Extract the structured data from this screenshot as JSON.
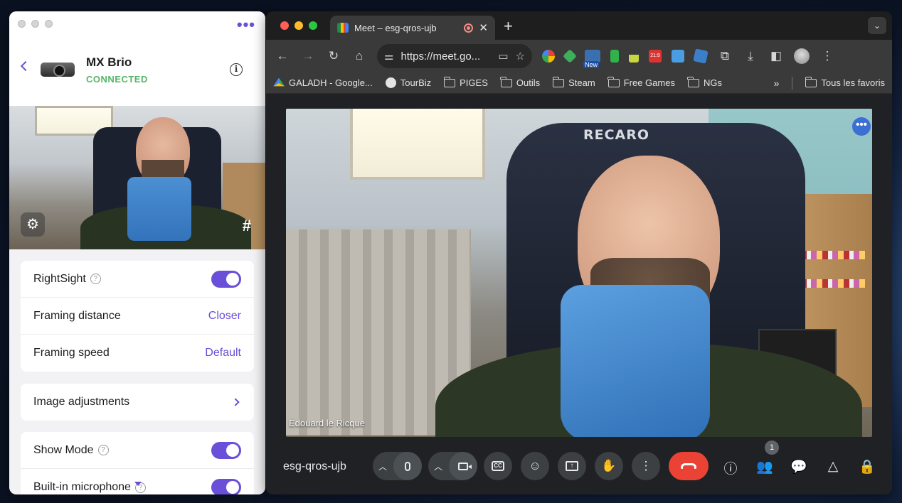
{
  "logi": {
    "more_icon": "ellipsis-icon",
    "device_name": "MX Brio",
    "device_status": "CONNECTED",
    "sections": {
      "rightsight_label": "RightSight",
      "framing_distance_label": "Framing distance",
      "framing_distance_value": "Closer",
      "framing_speed_label": "Framing speed",
      "framing_speed_value": "Default",
      "image_adjustments_label": "Image adjustments",
      "show_mode_label": "Show Mode",
      "builtin_mic_label": "Built-in microphone"
    },
    "toggles": {
      "rightsight": true,
      "show_mode": true,
      "builtin_mic": true
    },
    "accent_color": "#6a4fd8",
    "status_color": "#56b568"
  },
  "browser": {
    "tab_title": "Meet – esg-qros-ujb",
    "url": "https://meet.go...",
    "new_ext_badge": "New",
    "ext_badge_text": "21:9",
    "bookmarks": [
      "GALADH - Google...",
      "TourBiz",
      "PIGES",
      "Outils",
      "Steam",
      "Free Games",
      "NGs"
    ],
    "bookmarks_overflow": "»",
    "all_bookmarks": "Tous les favoris"
  },
  "meet": {
    "participant_name": "Edouard le Ricque",
    "chair_brand": "RECARO",
    "meeting_code": "esg-qros-ujb",
    "people_count": "1",
    "hangup_color": "#ea4335"
  }
}
